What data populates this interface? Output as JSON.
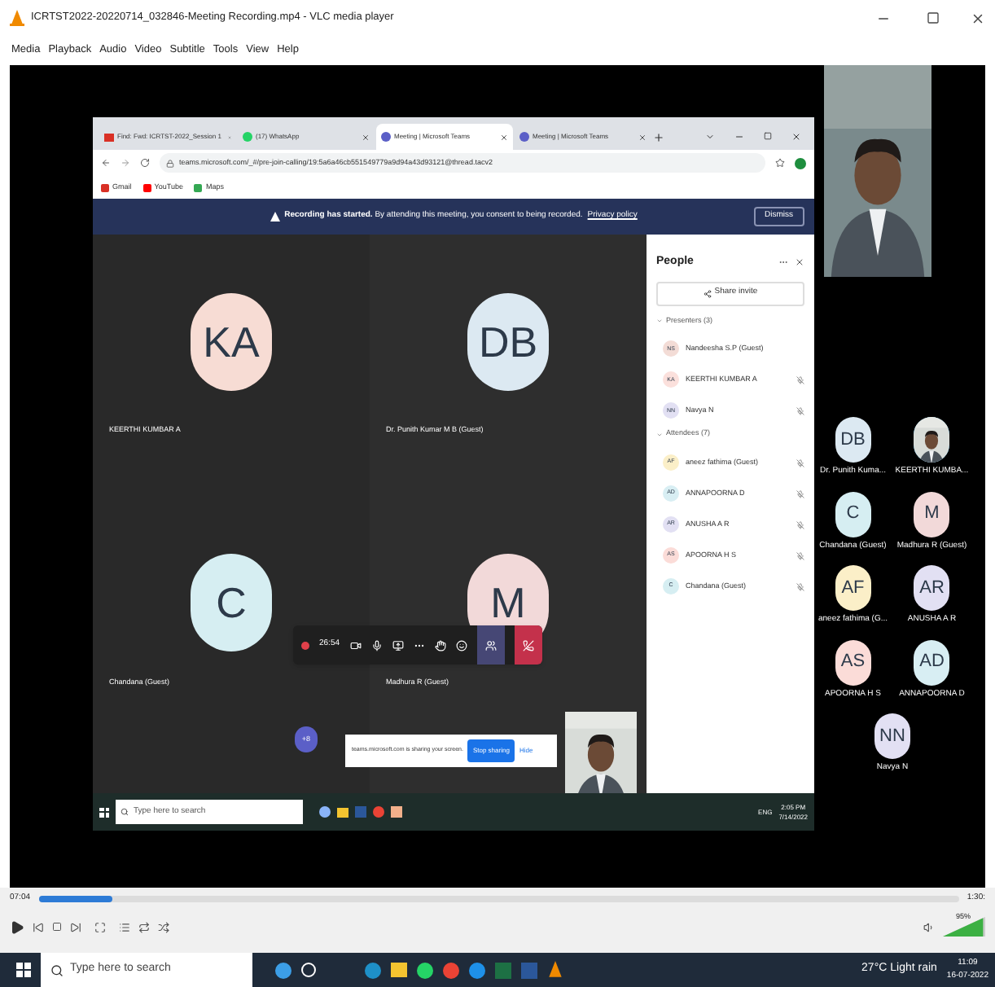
{
  "window": {
    "title": "ICRTST2022-20220714_032846-Meeting Recording.mp4 - VLC media player"
  },
  "menu": [
    "Media",
    "Playback",
    "Audio",
    "Video",
    "Subtitle",
    "Tools",
    "View",
    "Help"
  ],
  "browser": {
    "tabs": [
      {
        "label": "Find: Fwd: ICRTST-2022_Session 1",
        "selected": false,
        "kind": "mail"
      },
      {
        "label": "(17) WhatsApp",
        "selected": false,
        "kind": "chat"
      },
      {
        "label": "Meeting | Microsoft Teams",
        "selected": true,
        "kind": "teams"
      },
      {
        "label": "Meeting | Microsoft Teams",
        "selected": false,
        "kind": "teams"
      }
    ],
    "url": "teams.microsoft.com/_#/pre-join-calling/19:5a6a46cb551549779a9d94a43d93121@thread.tacv2",
    "bookmarks": [
      {
        "label": "Gmail",
        "color": "#d93025"
      },
      {
        "label": "YouTube",
        "color": "#ff0000"
      },
      {
        "label": "Maps",
        "color": "#34a853"
      }
    ]
  },
  "banner": {
    "text": "**Recording has started.** By attending this meeting, you consent to being recorded.",
    "link": "Privacy policy",
    "button": "Dismiss"
  },
  "tiles": [
    {
      "initials": "KA",
      "name": "KEERTHI KUMBAR A",
      "color": "#f7dcd4"
    },
    {
      "initials": "DB",
      "name": "Dr. Punith Kumar M B (Guest)",
      "color": "#dce9f2"
    },
    {
      "initials": "C",
      "name": "Chandana (Guest)",
      "color": "#d6eef2"
    },
    {
      "initials": "M",
      "name": "Madhura R (Guest)",
      "color": "#f2d9d9"
    }
  ],
  "call_toolbar": {
    "timer": "26:54"
  },
  "overflow": {
    "count": "+8"
  },
  "share_bar": {
    "text": "teams.microsoft.com is sharing your screen.",
    "button": "Stop sharing",
    "hide": "Hide"
  },
  "people": {
    "title": "People",
    "share": "Share invite",
    "groups": [
      {
        "label": "Presenters (3)",
        "expanded": true,
        "members": [
          {
            "initials": "NS",
            "name": "Nandeesha S.P (Guest)",
            "color": "#f3dcd6",
            "muted": false
          },
          {
            "initials": "KA",
            "name": "KEERTHI KUMBAR A",
            "color": "#fbe0dc",
            "muted": true
          },
          {
            "initials": "NN",
            "name": "Navya N",
            "color": "#e2e0f3",
            "muted": true
          }
        ]
      },
      {
        "label": "Attendees (7)",
        "expanded": true,
        "members": [
          {
            "initials": "AF",
            "name": "aneez fathima (Guest)",
            "color": "#fbefc8",
            "muted": true
          },
          {
            "initials": "AD",
            "name": "ANNAPOORNA D",
            "color": "#d8eef3",
            "muted": true
          },
          {
            "initials": "AR",
            "name": "ANUSHA A R",
            "color": "#e2e0f3",
            "muted": true
          },
          {
            "initials": "AS",
            "name": "APOORNA H S",
            "color": "#fbdcd8",
            "muted": true
          },
          {
            "initials": "C",
            "name": "Chandana (Guest)",
            "color": "#d6eef2",
            "muted": true
          }
        ]
      }
    ]
  },
  "inner_taskbar": {
    "search": "Type here to search",
    "lang": "ENG",
    "time": "2:05 PM",
    "date": "7/14/2022"
  },
  "gallery": [
    {
      "kind": "avatar",
      "initials": "DB",
      "name": "Dr. Punith Kuma...",
      "color": "#dce9f2"
    },
    {
      "kind": "picture",
      "name": "KEERTHI KUMBA..."
    },
    {
      "kind": "avatar",
      "initials": "C",
      "name": "Chandana (Guest)",
      "color": "#d6eef2"
    },
    {
      "kind": "avatar",
      "initials": "M",
      "name": "Madhura R (Guest)",
      "color": "#f2d9d9"
    },
    {
      "kind": "avatar",
      "initials": "AF",
      "name": "aneez fathima (G...",
      "color": "#fbefc8"
    },
    {
      "kind": "avatar",
      "initials": "AR",
      "name": "ANUSHA A R",
      "color": "#e2e0f3"
    },
    {
      "kind": "avatar",
      "initials": "AS",
      "name": "APOORNA H S",
      "color": "#fbdcd8"
    },
    {
      "kind": "avatar",
      "initials": "AD",
      "name": "ANNAPOORNA D",
      "color": "#d8eef3"
    },
    {
      "kind": "avatar",
      "initials": "NN",
      "name": "Navya N",
      "color": "#e2e0f3"
    }
  ],
  "player": {
    "elapsed": "07:04",
    "total": "1:30:",
    "level": 0.08,
    "volume": {
      "text": "95%",
      "level": 0.95
    }
  },
  "taskbar": {
    "search": "Type here to search",
    "weather": "27°C Light rain",
    "time": "11:09",
    "date": "16-07-2022"
  }
}
